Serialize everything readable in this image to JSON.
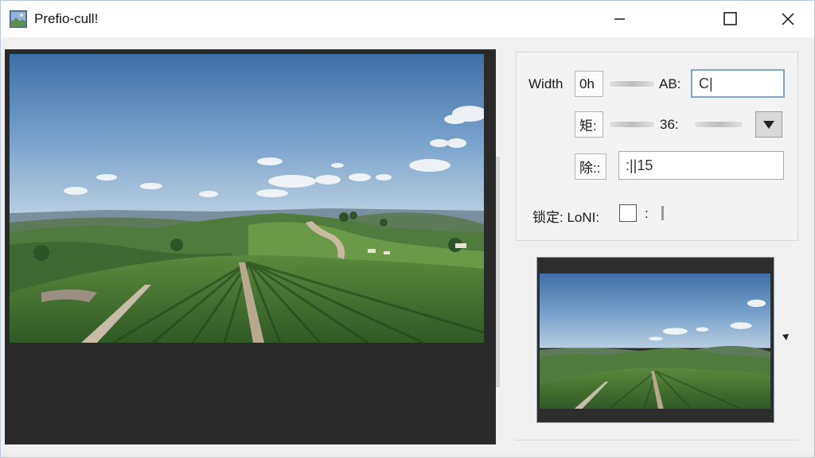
{
  "window": {
    "title": "Prefio-cull!",
    "controls": [
      "minimize",
      "maximize",
      "close"
    ]
  },
  "settings": {
    "width_label": "Width",
    "row1": {
      "box": "0h",
      "label": "AB:",
      "input_value": "C|"
    },
    "row2": {
      "box": "矩:",
      "label": "36:"
    },
    "row3": {
      "box": "除::",
      "input_value": ":||15"
    },
    "lock": {
      "label": "锁定: LoNI:",
      "colon": ":"
    }
  },
  "icons": {
    "app": "app-photo-icon",
    "dropdown": "triangle-down-icon",
    "thumb_menu": "small-arrow-icon"
  },
  "colors": {
    "accent_border": "#7ea6cf",
    "panel_dark": "#2a2a2a"
  }
}
